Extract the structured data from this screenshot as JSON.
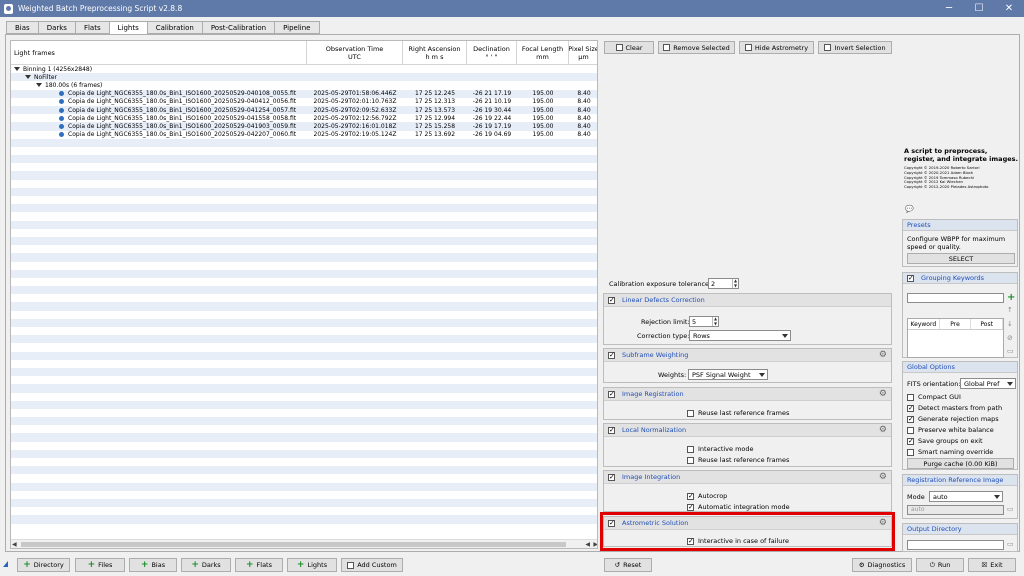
{
  "window": {
    "title": "Weighted Batch Preprocessing Script v2.8.8"
  },
  "tabs": [
    "Bias",
    "Darks",
    "Flats",
    "Lights",
    "Calibration",
    "Post-Calibration",
    "Pipeline"
  ],
  "active_tab": "Lights",
  "table": {
    "columns": [
      {
        "line1": "Light frames",
        "line2": ""
      },
      {
        "line1": "Observation Time",
        "line2": "UTC"
      },
      {
        "line1": "Right Ascension",
        "line2": "h  m  s"
      },
      {
        "line1": "Declination",
        "line2": "°  '  \""
      },
      {
        "line1": "Focal Length",
        "line2": "mm"
      },
      {
        "line1": "Pixel Size",
        "line2": "µm"
      }
    ],
    "groups": {
      "binning": "Binning 1 (4256x2848)",
      "filter": "NoFilter",
      "exposure": "180.00s (6 frames)"
    },
    "rows": [
      {
        "file": "Copia de Light_NGC6355_180.0s_Bin1_ISO1600_20250529-040108_0055.fit",
        "time": "2025-05-29T01:58:06.446Z",
        "ra": "17 25 12.245",
        "dec": "-26 21 17.19",
        "focal": "195.00",
        "pixel": "8.40"
      },
      {
        "file": "Copia de Light_NGC6355_180.0s_Bin1_ISO1600_20250529-040412_0056.fit",
        "time": "2025-05-29T02:01:10.763Z",
        "ra": "17 25 12.313",
        "dec": "-26 21 10.19",
        "focal": "195.00",
        "pixel": "8.40"
      },
      {
        "file": "Copia de Light_NGC6355_180.0s_Bin1_ISO1600_20250529-041254_0057.fit",
        "time": "2025-05-29T02:09:52.633Z",
        "ra": "17 25 13.573",
        "dec": "-26 19 30.44",
        "focal": "195.00",
        "pixel": "8.40"
      },
      {
        "file": "Copia de Light_NGC6355_180.0s_Bin1_ISO1600_20250529-041558_0058.fit",
        "time": "2025-05-29T02:12:56.792Z",
        "ra": "17 25 12.994",
        "dec": "-26 19 22.44",
        "focal": "195.00",
        "pixel": "8.40"
      },
      {
        "file": "Copia de Light_NGC6355_180.0s_Bin1_ISO1600_20250529-041903_0059.fit",
        "time": "2025-05-29T02:16:01.018Z",
        "ra": "17 25 15.258",
        "dec": "-26 19 17.19",
        "focal": "195.00",
        "pixel": "8.40"
      },
      {
        "file": "Copia de Light_NGC6355_180.0s_Bin1_ISO1600_20250529-042207_0060.fit",
        "time": "2025-05-29T02:19:05.124Z",
        "ra": "17 25 13.692",
        "dec": "-26 19 04.69",
        "focal": "195.00",
        "pixel": "8.40"
      }
    ]
  },
  "top_buttons": {
    "clear": "Clear",
    "remove_selected": "Remove Selected",
    "hide_astrometry": "Hide Astrometry",
    "invert_selection": "Invert Selection"
  },
  "calibration": {
    "tolerance_label": "Calibration exposure tolerance:",
    "tolerance_value": "2"
  },
  "sections": {
    "linear_defects": {
      "title": "Linear Defects Correction",
      "rejection_label": "Rejection limit:",
      "rejection_value": "5",
      "correction_label": "Correction type:",
      "correction_value": "Rows"
    },
    "subframe_weighting": {
      "title": "Subframe Weighting",
      "weights_label": "Weights:",
      "weights_value": "PSF Signal Weight"
    },
    "image_registration": {
      "title": "Image Registration",
      "reuse_label": "Reuse last reference frames"
    },
    "local_normalization": {
      "title": "Local Normalization",
      "interactive_label": "Interactive mode",
      "reuse_label": "Reuse last reference frames"
    },
    "image_integration": {
      "title": "Image Integration",
      "autocrop_label": "Autocrop",
      "auto_mode_label": "Automatic integration mode"
    },
    "astrometric_solution": {
      "title": "Astrometric Solution",
      "interactive_label": "Interactive in case of failure"
    }
  },
  "info": {
    "title": "A script to preprocess, register, and integrate images.",
    "copyright": [
      "Copyright © 2019-2020 Roberto Sartori",
      "Copyright © 2020-2021 Adam Block",
      "Copyright © 2019 Tommaso Rubechi",
      "Copyright © 2012 Kai Wiechen",
      "Copyright © 2012-2020 Pleiades Astrophoto"
    ]
  },
  "presets": {
    "title": "Presets",
    "text": "Configure WBPP for maximum speed or quality.",
    "select": "SELECT"
  },
  "grouping": {
    "title": "Grouping Keywords",
    "cols": [
      "Keyword",
      "Pre",
      "Post"
    ]
  },
  "global_options": {
    "title": "Global Options",
    "fits_label": "FITS orientation:",
    "fits_value": "Global Pref",
    "options": [
      "Compact GUI",
      "Detect masters from path",
      "Generate rejection maps",
      "Preserve white balance",
      "Save groups on exit",
      "Smart naming override"
    ],
    "purge": "Purge cache (0.00 KiB)"
  },
  "registration_ref": {
    "title": "Registration Reference Image",
    "mode_label": "Mode",
    "mode_value": "auto",
    "auto_text": "auto"
  },
  "output_dir": {
    "title": "Output Directory"
  },
  "bottom": {
    "directory": "Directory",
    "files": "Files",
    "bias": "Bias",
    "darks": "Darks",
    "flats": "Flats",
    "lights": "Lights",
    "add_custom": "Add Custom",
    "reset": "Reset",
    "diagnostics": "Diagnostics",
    "run": "Run",
    "exit": "Exit"
  }
}
